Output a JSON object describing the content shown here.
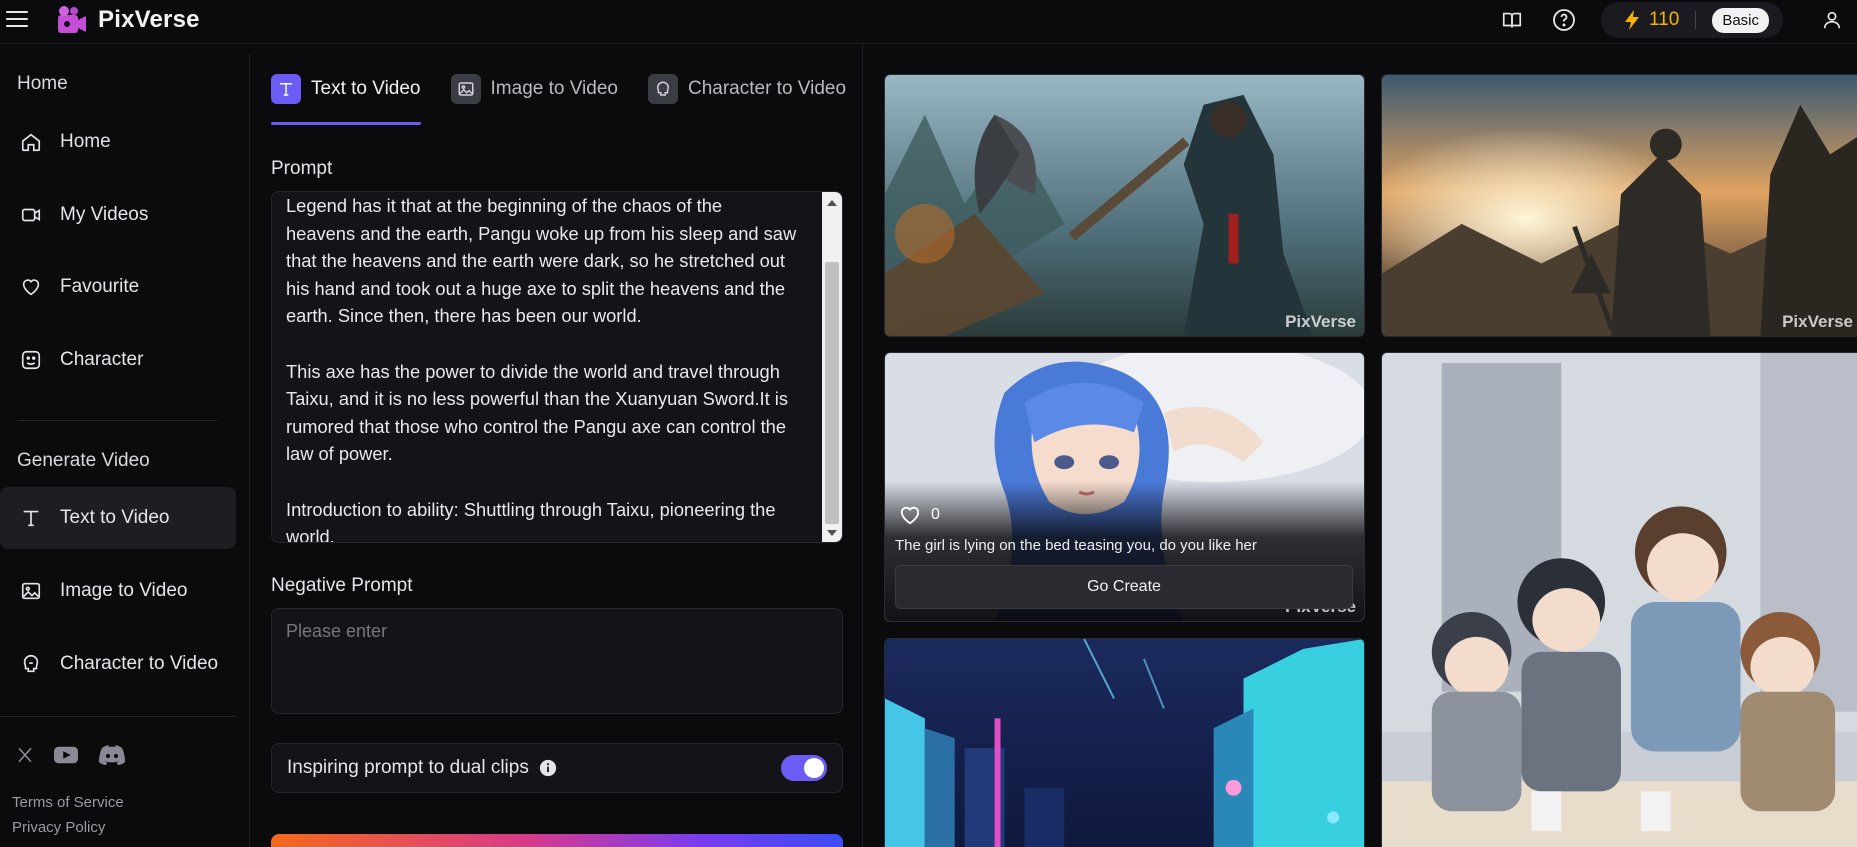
{
  "app": {
    "name": "PixVerse"
  },
  "topbar": {
    "credits": "110",
    "plan": "Basic",
    "accent": "#6b5cf6",
    "credit_color": "#f5b300"
  },
  "sidebar": {
    "section_home": "Home",
    "home_items": [
      {
        "label": "Home",
        "icon": "home-icon"
      },
      {
        "label": "My Videos",
        "icon": "video-icon"
      },
      {
        "label": "Favourite",
        "icon": "heart-icon"
      },
      {
        "label": "Character",
        "icon": "character-icon"
      }
    ],
    "section_generate": "Generate Video",
    "generate_items": [
      {
        "label": "Text to Video",
        "icon": "text-icon",
        "active": true
      },
      {
        "label": "Image to Video",
        "icon": "image-icon"
      },
      {
        "label": "Character to Video",
        "icon": "character-video-icon"
      }
    ],
    "terms": "Terms of Service",
    "privacy": "Privacy Policy"
  },
  "form": {
    "tabs": [
      {
        "label": "Text to Video",
        "active": true
      },
      {
        "label": "Image to Video"
      },
      {
        "label": "Character to Video"
      }
    ],
    "prompt_label": "Prompt",
    "prompt_value": "Legend has it that at the beginning of the chaos of the\nheavens and the earth, Pangu woke up from his sleep and saw\nthat the heavens and the earth were dark, so he stretched out\nhis hand and took out a huge axe to split the heavens and the\nearth. Since then, there has been our world.\n\nThis axe has the power to divide the world and travel through\nTaixu, and it is no less powerful than the Xuanyuan Sword.It is\nrumored that those who control the Pangu axe can control the\nlaw of power.\n\nIntroduction to ability: Shuttling through Taixu, pioneering the\nworld.",
    "negative_label": "Negative Prompt",
    "negative_placeholder": "Please enter",
    "dual_clips_label": "Inspiring prompt to dual clips",
    "dual_clips_on": true
  },
  "gallery": {
    "watermark": "PixVerse",
    "featured": {
      "likes": "0",
      "caption": "The girl is lying on the bed teasing you, do you like her",
      "button": "Go Create"
    }
  }
}
